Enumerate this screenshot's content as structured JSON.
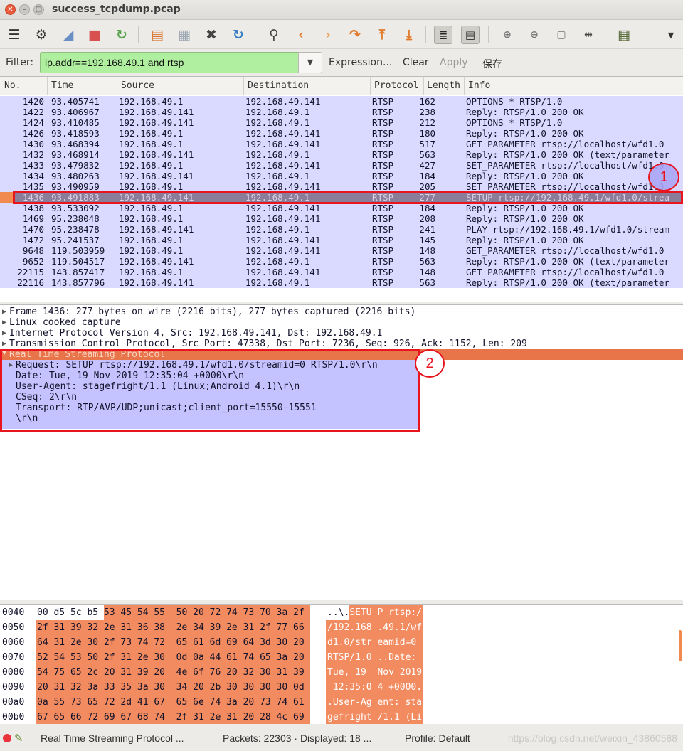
{
  "window": {
    "title": "success_tcpdump.pcap"
  },
  "toolbar": {
    "icons": [
      "interfaces-icon",
      "options-icon",
      "start-capture-icon",
      "stop-capture-icon",
      "restart-capture-icon",
      "open-file-icon",
      "save-file-icon",
      "close-file-icon",
      "reload-icon",
      "find-icon",
      "back-icon",
      "forward-icon",
      "goto-packet-icon",
      "first-packet-icon",
      "last-packet-icon",
      "colorize-icon",
      "autoscroll-icon",
      "zoom-in-icon",
      "zoom-out-icon",
      "normal-size-icon",
      "resize-columns-icon",
      "capture-filters-icon",
      "more-icon"
    ]
  },
  "filter": {
    "label": "Filter:",
    "value": "ip.addr==192.168.49.1 and rtsp",
    "expression": "Expression...",
    "clear": "Clear",
    "apply": "Apply",
    "save": "保存"
  },
  "packet_list": {
    "columns": [
      "No.",
      "Time",
      "Source",
      "Destination",
      "Protocol",
      "Length",
      "Info"
    ],
    "rows": [
      {
        "no": "1420",
        "time": "93.405741",
        "src": "192.168.49.1",
        "dst": "192.168.49.141",
        "proto": "RTSP",
        "len": "162",
        "info": "OPTIONS * RTSP/1.0"
      },
      {
        "no": "1422",
        "time": "93.406967",
        "src": "192.168.49.141",
        "dst": "192.168.49.1",
        "proto": "RTSP",
        "len": "238",
        "info": "Reply: RTSP/1.0 200 OK"
      },
      {
        "no": "1424",
        "time": "93.410485",
        "src": "192.168.49.141",
        "dst": "192.168.49.1",
        "proto": "RTSP",
        "len": "212",
        "info": "OPTIONS * RTSP/1.0"
      },
      {
        "no": "1426",
        "time": "93.418593",
        "src": "192.168.49.1",
        "dst": "192.168.49.141",
        "proto": "RTSP",
        "len": "180",
        "info": "Reply: RTSP/1.0 200 OK"
      },
      {
        "no": "1430",
        "time": "93.468394",
        "src": "192.168.49.1",
        "dst": "192.168.49.141",
        "proto": "RTSP",
        "len": "517",
        "info": "GET_PARAMETER rtsp://localhost/wfd1.0"
      },
      {
        "no": "1432",
        "time": "93.468914",
        "src": "192.168.49.141",
        "dst": "192.168.49.1",
        "proto": "RTSP",
        "len": "563",
        "info": "Reply: RTSP/1.0 200 OK (text/parameter"
      },
      {
        "no": "1433",
        "time": "93.479832",
        "src": "192.168.49.1",
        "dst": "192.168.49.141",
        "proto": "RTSP",
        "len": "427",
        "info": "SET_PARAMETER rtsp://localhost/wfd1.0"
      },
      {
        "no": "1434",
        "time": "93.480263",
        "src": "192.168.49.141",
        "dst": "192.168.49.1",
        "proto": "RTSP",
        "len": "184",
        "info": "Reply: RTSP/1.0 200 OK"
      },
      {
        "no": "1435",
        "time": "93.490959",
        "src": "192.168.49.1",
        "dst": "192.168.49.141",
        "proto": "RTSP",
        "len": "205",
        "info": "SET_PARAMETER rtsp://localhost/wfd1.0"
      },
      {
        "no": "1436",
        "time": "93.491883",
        "src": "192.168.49.141",
        "dst": "192.168.49.1",
        "proto": "RTSP",
        "len": "277",
        "info": "SETUP rtsp://192.168.49.1/wfd1.0/strea"
      },
      {
        "no": "1438",
        "time": "93.533092",
        "src": "192.168.49.1",
        "dst": "192.168.49.141",
        "proto": "RTSP",
        "len": "184",
        "info": "Reply: RTSP/1.0 200 OK"
      },
      {
        "no": "1469",
        "time": "95.238048",
        "src": "192.168.49.1",
        "dst": "192.168.49.141",
        "proto": "RTSP",
        "len": "208",
        "info": "Reply: RTSP/1.0 200 OK"
      },
      {
        "no": "1470",
        "time": "95.238478",
        "src": "192.168.49.141",
        "dst": "192.168.49.1",
        "proto": "RTSP",
        "len": "241",
        "info": "PLAY rtsp://192.168.49.1/wfd1.0/stream"
      },
      {
        "no": "1472",
        "time": "95.241537",
        "src": "192.168.49.1",
        "dst": "192.168.49.141",
        "proto": "RTSP",
        "len": "145",
        "info": "Reply: RTSP/1.0 200 OK"
      },
      {
        "no": "9648",
        "time": "119.503959",
        "src": "192.168.49.1",
        "dst": "192.168.49.141",
        "proto": "RTSP",
        "len": "148",
        "info": "GET_PARAMETER rtsp://localhost/wfd1.0"
      },
      {
        "no": "9652",
        "time": "119.504517",
        "src": "192.168.49.141",
        "dst": "192.168.49.1",
        "proto": "RTSP",
        "len": "563",
        "info": "Reply: RTSP/1.0 200 OK (text/parameter"
      },
      {
        "no": "22115",
        "time": "143.857417",
        "src": "192.168.49.1",
        "dst": "192.168.49.141",
        "proto": "RTSP",
        "len": "148",
        "info": "GET_PARAMETER rtsp://localhost/wfd1.0"
      },
      {
        "no": "22116",
        "time": "143.857796",
        "src": "192.168.49.141",
        "dst": "192.168.49.1",
        "proto": "RTSP",
        "len": "563",
        "info": "Reply: RTSP/1.0 200 OK (text/parameter"
      }
    ],
    "selected_index": 9
  },
  "details": {
    "lines": [
      "Frame 1436: 277 bytes on wire (2216 bits), 277 bytes captured (2216 bits)",
      "Linux cooked capture",
      "Internet Protocol Version 4, Src: 192.168.49.141, Dst: 192.168.49.1",
      "Transmission Control Protocol, Src Port: 47338, Dst Port: 7236, Seq: 926, Ack: 1152, Len: 209"
    ],
    "rtsp": "Real Time Streaming Protocol",
    "rtsp_lines": [
      "Request: SETUP rtsp://192.168.49.1/wfd1.0/streamid=0 RTSP/1.0\\r\\n",
      "Date: Tue, 19 Nov 2019 12:35:04 +0000\\r\\n",
      "User-Agent: stagefright/1.1 (Linux;Android 4.1)\\r\\n",
      "CSeq: 2\\r\\n",
      "Transport: RTP/AVP/UDP;unicast;client_port=15550-15551",
      "\\r\\n"
    ]
  },
  "annotations": {
    "one": "1",
    "two": "2"
  },
  "bytes": {
    "rows": [
      {
        "off": "0040",
        "hex": "00 d5 5c b5 53 45 54 55  50 20 72 74 73 70 3a 2f",
        "ascii_a": "..\\.",
        "ascii_b": "SETU P rtsp:/"
      },
      {
        "off": "0050",
        "hex": "2f 31 39 32 2e 31 36 38  2e 34 39 2e 31 2f 77 66",
        "ascii": "/192.168 .49.1/wf"
      },
      {
        "off": "0060",
        "hex": "64 31 2e 30 2f 73 74 72  65 61 6d 69 64 3d 30 20",
        "ascii": "d1.0/str eamid=0 "
      },
      {
        "off": "0070",
        "hex": "52 54 53 50 2f 31 2e 30  0d 0a 44 61 74 65 3a 20",
        "ascii": "RTSP/1.0 ..Date: "
      },
      {
        "off": "0080",
        "hex": "54 75 65 2c 20 31 39 20  4e 6f 76 20 32 30 31 39",
        "ascii": "Tue, 19  Nov 2019"
      },
      {
        "off": "0090",
        "hex": "20 31 32 3a 33 35 3a 30  34 20 2b 30 30 30 30 0d",
        "ascii": " 12:35:0 4 +0000."
      },
      {
        "off": "00a0",
        "hex": "0a 55 73 65 72 2d 41 67  65 6e 74 3a 20 73 74 61",
        "ascii": ".User-Ag ent: sta"
      },
      {
        "off": "00b0",
        "hex": "67 65 66 72 69 67 68 74  2f 31 2e 31 20 28 4c 69",
        "ascii": "gefright /1.1 (Li"
      }
    ]
  },
  "status": {
    "left": "Real Time Streaming Protocol ...",
    "packets": "Packets: 22303 · Displayed: 18 ...",
    "profile": "Profile: Default",
    "watermark": "https://blog.csdn.net/weixin_43860588"
  }
}
